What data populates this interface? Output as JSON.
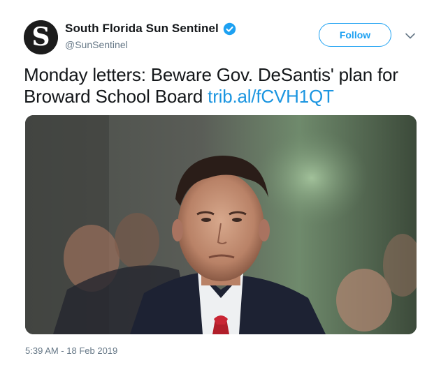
{
  "account": {
    "display_name": "South Florida Sun Sentinel",
    "handle": "@SunSentinel",
    "verified": true,
    "avatar_icon": "sun-sentinel-s-logo-icon"
  },
  "actions": {
    "follow_label": "Follow",
    "caret_icon": "chevron-down-icon"
  },
  "tweet": {
    "text": "Monday letters: Beware Gov. DeSantis' plan for Broward School Board ",
    "link_text": "trib.al/fCVH1QT",
    "media_description_icon": "photo",
    "timestamp": "5:39 AM - 18 Feb 2019"
  },
  "colors": {
    "accent": "#1da1f2",
    "link": "#1b95e0",
    "text": "#14171a",
    "secondary": "#657786"
  }
}
